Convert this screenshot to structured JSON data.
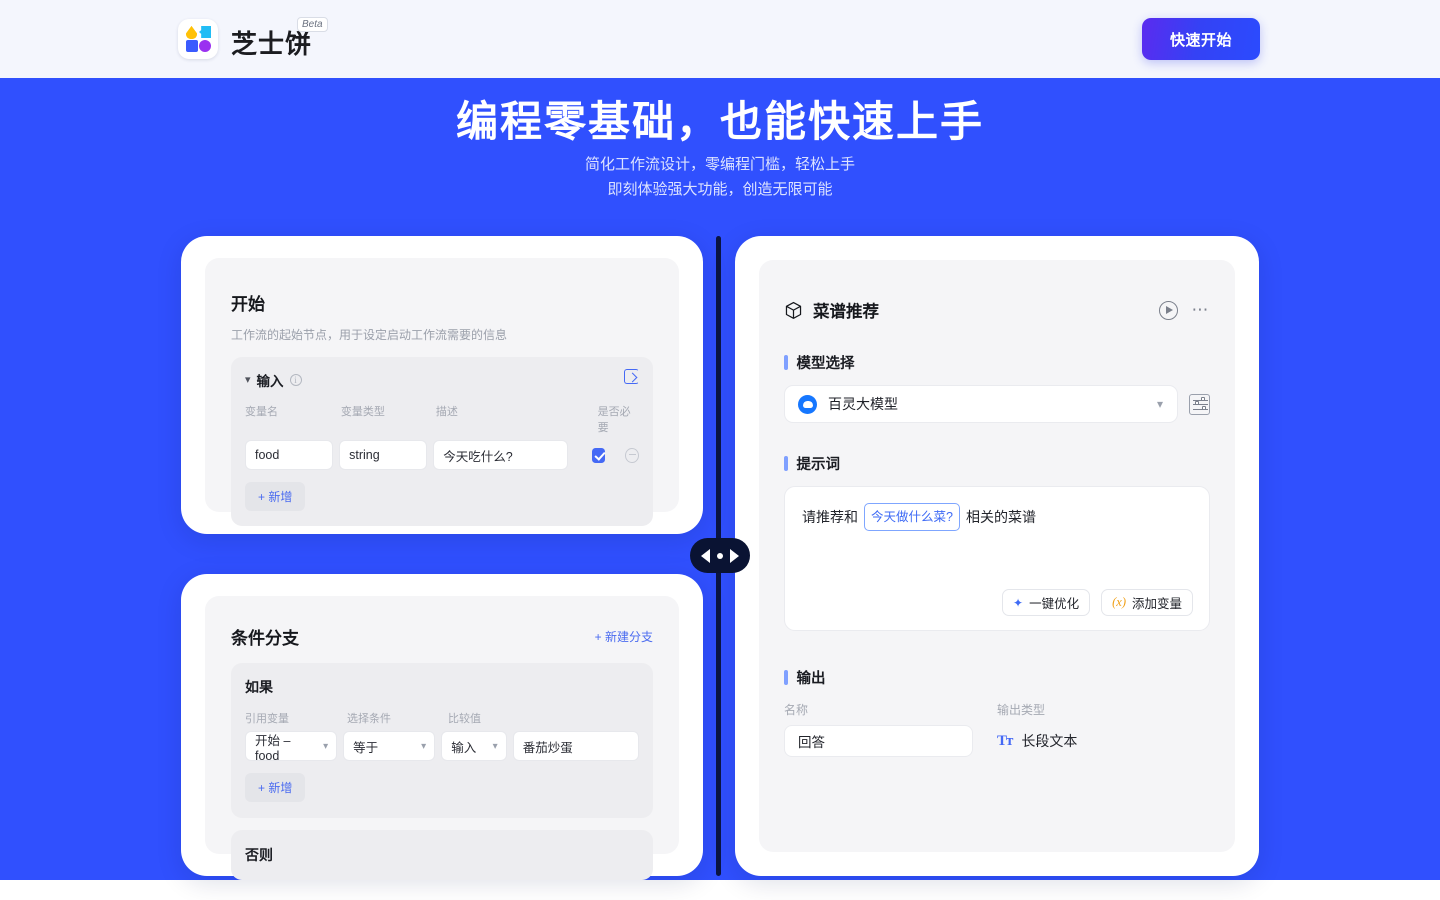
{
  "header": {
    "brand_name": "芝士饼",
    "beta_tag": "Beta",
    "cta_label": "快速开始"
  },
  "hero": {
    "title": "编程零基础，也能快速上手",
    "subtitle_line1": "简化工作流设计，零编程门槛，轻松上手",
    "subtitle_line2": "即刻体验强大功能，创造无限可能"
  },
  "start_node": {
    "title": "开始",
    "description": "工作流的起始节点，用于设定启动工作流需要的信息",
    "section_title": "输入",
    "columns": [
      "变量名",
      "变量类型",
      "描述",
      "是否必要"
    ],
    "rows": [
      {
        "name": "food",
        "type": "string",
        "desc": "今天吃什么?",
        "required": true
      }
    ],
    "add_label": "+ 新增"
  },
  "condition_node": {
    "title": "条件分支",
    "new_branch_label": "+ 新建分支",
    "if_label": "如果",
    "columns": [
      "引用变量",
      "选择条件",
      "比较值"
    ],
    "row": {
      "variable": "开始 – food",
      "operator": "等于",
      "value_type": "输入",
      "value": "番茄炒蛋"
    },
    "add_label": "+ 新增",
    "else_label": "否则"
  },
  "llm_node": {
    "title": "菜谱推荐",
    "model_section_label": "模型选择",
    "model_name": "百灵大模型",
    "prompt_section_label": "提示词",
    "prompt_prefix": "请推荐和",
    "prompt_variable": "今天做什么菜?",
    "prompt_suffix": "相关的菜谱",
    "optimize_label": "一键优化",
    "add_variable_label": "添加变量",
    "x_symbol": "(x)",
    "output_section_label": "输出",
    "output_name_label": "名称",
    "output_name_value": "回答",
    "output_type_label": "输出类型",
    "output_type_value": "长段文本",
    "output_type_icon_text": "Tт"
  },
  "colors": {
    "hero_blue": "#3050FE",
    "accent_blue": "#4569F5",
    "header_bg": "#F4F6FD",
    "panel_gray": "#F5F5F7"
  }
}
